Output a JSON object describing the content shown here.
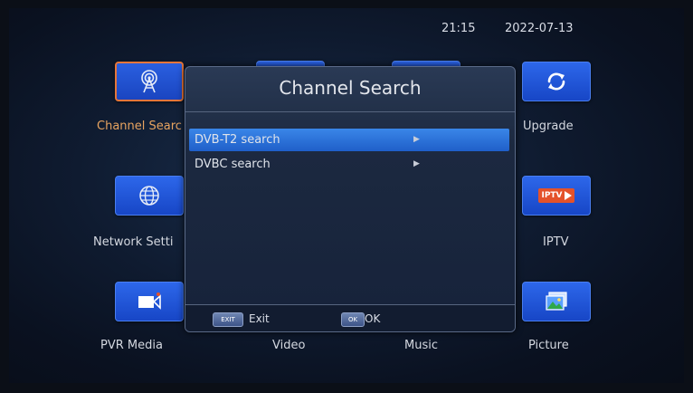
{
  "status": {
    "time": "21:15",
    "date": "2022-07-13"
  },
  "tiles": [
    {
      "id": "channel-search",
      "label": "Channel Searc",
      "icon": "antenna-icon",
      "selected": true
    },
    {
      "id": "upgrade",
      "label": "Upgrade",
      "icon": "refresh-icon"
    },
    {
      "id": "network-settings",
      "label": "Network Setti",
      "icon": "globe-icon"
    },
    {
      "id": "iptv",
      "label": "IPTV",
      "icon": "iptv-icon",
      "icon_text": "IPTV"
    },
    {
      "id": "pvr-media",
      "label": "PVR Media",
      "icon": "video-camera-icon"
    },
    {
      "id": "video",
      "label": "Video"
    },
    {
      "id": "music",
      "label": "Music"
    },
    {
      "id": "picture",
      "label": "Picture",
      "icon": "picture-icon"
    }
  ],
  "dialog": {
    "title": "Channel Search",
    "items": [
      {
        "label": "DVB-T2 search",
        "selected": true
      },
      {
        "label": "DVBC search",
        "selected": false
      }
    ],
    "footer": {
      "exit_key": "EXIT",
      "exit_label": "Exit",
      "ok_key": "OK",
      "ok_label": "OK"
    }
  },
  "colors": {
    "tile_blue": "#2359dc",
    "selected_border": "#e6763a",
    "selected_row": "#2f76df",
    "active_label": "#e8a460",
    "iptv_badge": "#e4522a"
  }
}
